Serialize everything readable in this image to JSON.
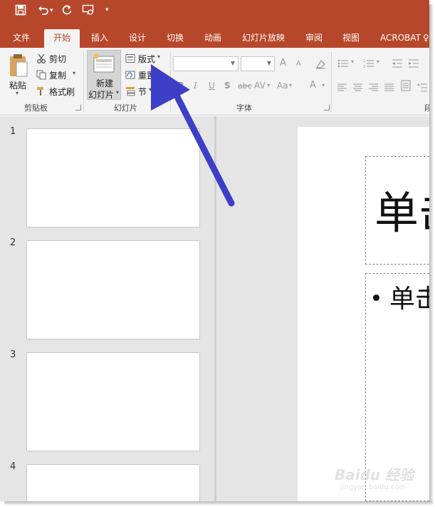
{
  "colors": {
    "accent": "#b7472a",
    "ribbon": "#f3f3f3",
    "workspace": "#e5e5e5",
    "annotation_arrow": "#3d3fc9"
  },
  "quick_access": {
    "save_icon": "save-icon",
    "undo_icon": "undo-icon",
    "redo_icon": "redo-icon",
    "present_icon": "present-from-start-icon",
    "customize_icon": "customize-qat-icon"
  },
  "tabs": [
    {
      "label": "文件"
    },
    {
      "label": "开始",
      "active": true
    },
    {
      "label": "插入"
    },
    {
      "label": "设计"
    },
    {
      "label": "切换"
    },
    {
      "label": "动画"
    },
    {
      "label": "幻灯片放映"
    },
    {
      "label": "审阅"
    },
    {
      "label": "视图"
    },
    {
      "label": "ACROBAT"
    },
    {
      "label": "♀"
    }
  ],
  "clipboard": {
    "paste": "粘贴",
    "cut": "剪切",
    "copy": "复制",
    "format_painter": "格式刷",
    "group_label": "剪贴板"
  },
  "slides": {
    "new_slide_line1": "新建",
    "new_slide_line2": "幻灯片",
    "layout": "版式",
    "reset": "重置",
    "section": "节",
    "group_label": "幻灯片"
  },
  "font": {
    "font_name": "",
    "font_size": "",
    "grow": "A",
    "shrink": "A",
    "bold": "B",
    "italic": "I",
    "underline": "U",
    "shadow": "S",
    "strike": "abc",
    "spacing": "AV",
    "case": "Aa",
    "color": "A",
    "group_label": "字体"
  },
  "paragraph": {
    "group_label_partial": "段"
  },
  "thumbnails": [
    {
      "number": "1"
    },
    {
      "number": "2"
    },
    {
      "number": "3"
    },
    {
      "number": "4"
    }
  ],
  "canvas": {
    "title_text": "单击",
    "bullet_text": "单击"
  },
  "watermark": {
    "brand": "Baidu 经验",
    "url": "jingyan.baidu.com"
  }
}
